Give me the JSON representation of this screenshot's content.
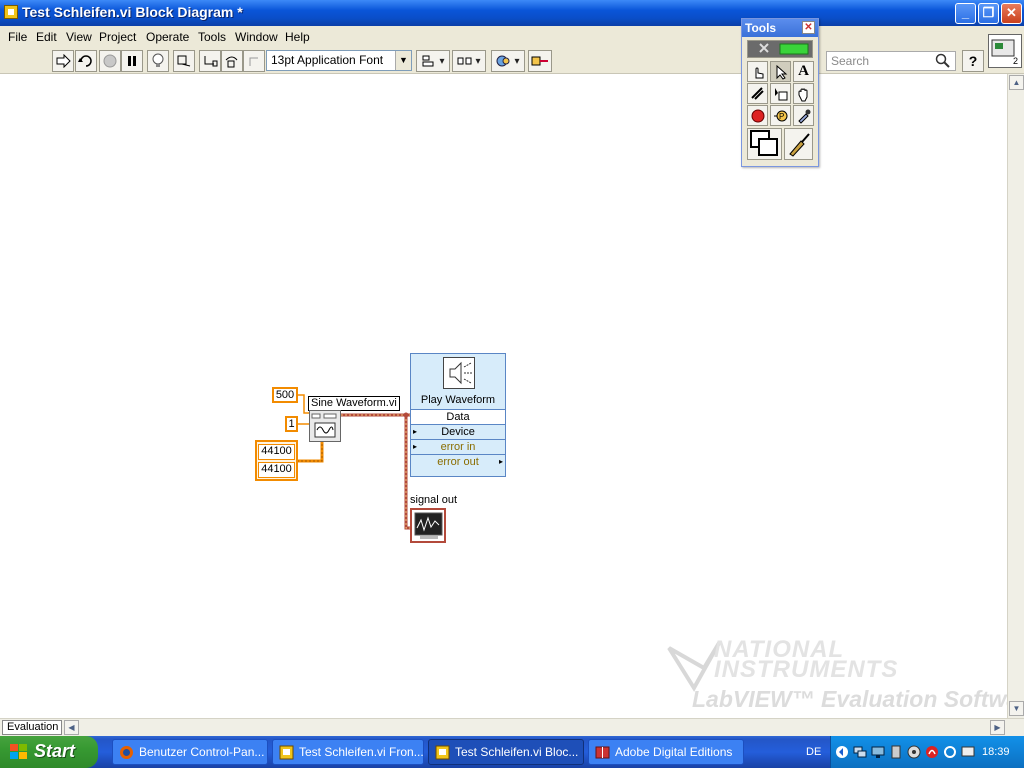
{
  "window": {
    "title": "Test Schleifen.vi Block Diagram *"
  },
  "menu": [
    "File",
    "Edit",
    "View",
    "Project",
    "Operate",
    "Tools",
    "Window",
    "Help"
  ],
  "toolbar": {
    "font": "13pt Application Font",
    "search_placeholder": "Search"
  },
  "tools_palette": {
    "title": "Tools"
  },
  "diagram": {
    "const_500": "500",
    "const_1": "1",
    "const_44100a": "44100",
    "const_44100b": "44100",
    "sine_label": "Sine Waveform.vi",
    "play_title": "Play Waveform",
    "play_terminals": [
      "Data",
      "Device",
      "error in",
      "error out"
    ],
    "indicator_label": "signal out"
  },
  "watermark": {
    "line1": "NATIONAL",
    "line2": "INSTRUMENTS",
    "line3": "LabVIEW™ Evaluation Software"
  },
  "bottom": {
    "eval_tab": "Evaluation"
  },
  "taskbar": {
    "start": "Start",
    "tasks": [
      "Benutzer Control-Pan...",
      "Test Schleifen.vi Fron...",
      "Test Schleifen.vi Bloc...",
      "Adobe Digital Editions"
    ],
    "language": "DE",
    "clock": "18:39"
  },
  "colors": {
    "constant_orange": "#f28b00",
    "wire_waveform": "#b34a3b",
    "play_node_blue": "#d7ecfa"
  }
}
